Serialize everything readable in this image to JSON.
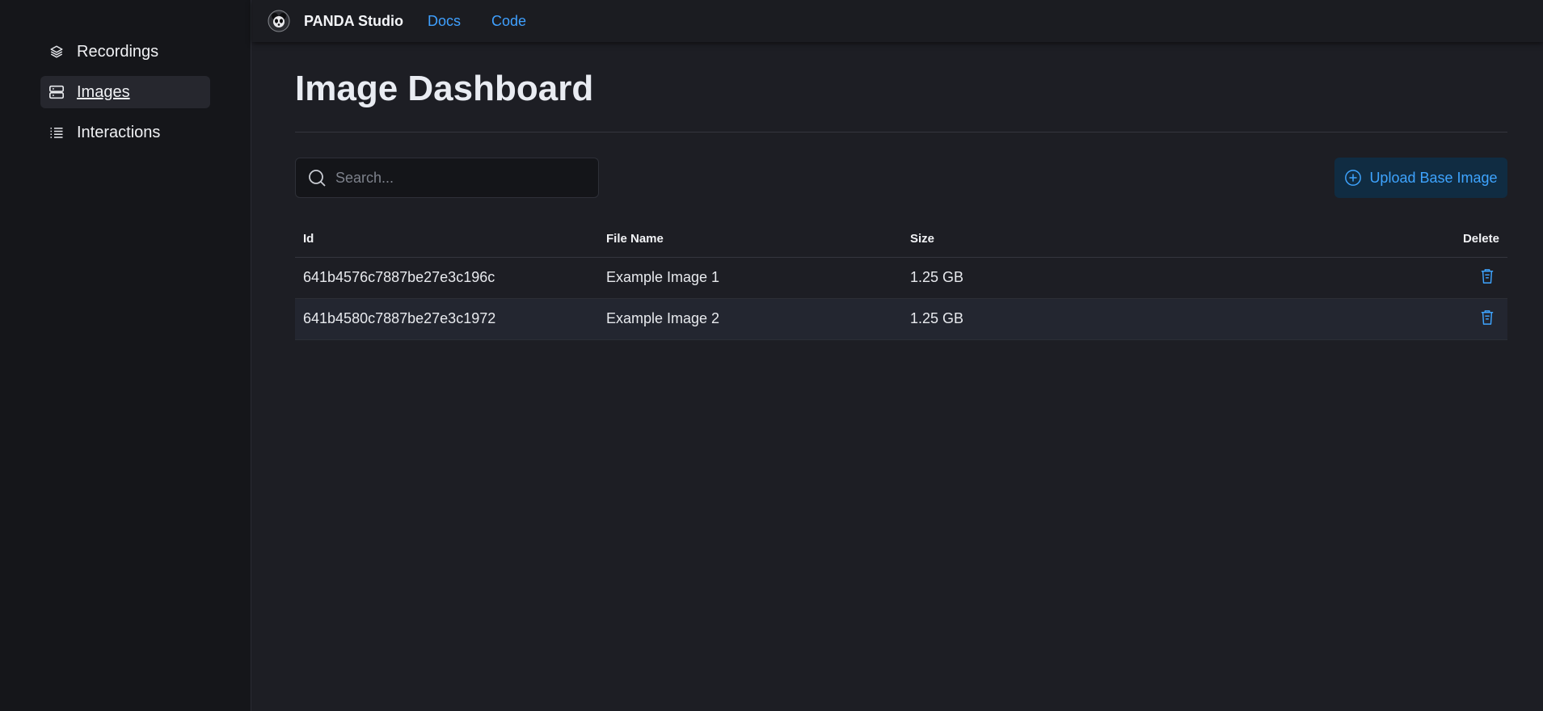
{
  "sidebar": {
    "items": [
      {
        "label": "Recordings",
        "icon": "layers-icon",
        "active": false
      },
      {
        "label": "Images",
        "icon": "server-icon",
        "active": true
      },
      {
        "label": "Interactions",
        "icon": "list-icon",
        "active": false
      }
    ]
  },
  "topbar": {
    "brand": "PANDA Studio",
    "links": [
      "Docs",
      "Code"
    ]
  },
  "main": {
    "title": "Image Dashboard",
    "search": {
      "placeholder": "Search...",
      "value": ""
    },
    "upload_label": "Upload Base Image",
    "table": {
      "headers": [
        "Id",
        "File Name",
        "Size",
        "Delete"
      ],
      "rows": [
        {
          "id": "641b4576c7887be27e3c196c",
          "file_name": "Example Image 1",
          "size": "1.25 GB"
        },
        {
          "id": "641b4580c7887be27e3c1972",
          "file_name": "Example Image 2",
          "size": "1.25 GB"
        }
      ]
    }
  },
  "colors": {
    "accent": "#3ea4ff",
    "background": "#1d1e24",
    "sidebar": "#15161a"
  }
}
